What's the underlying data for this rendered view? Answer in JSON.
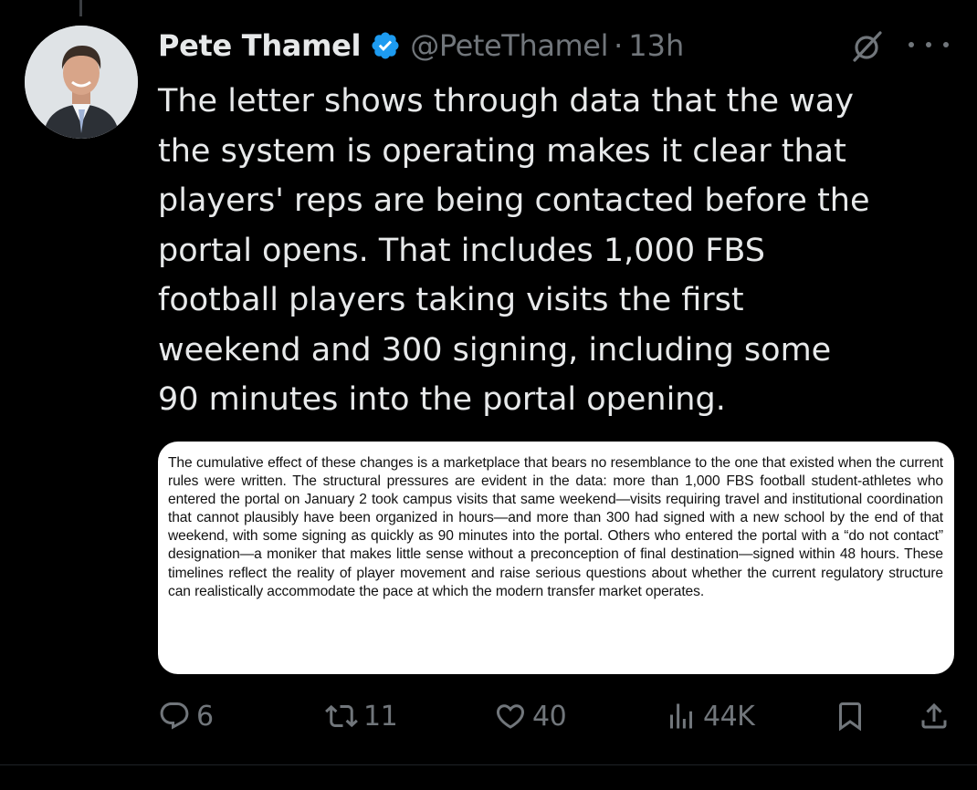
{
  "tweet": {
    "author_name": "Pete Thamel",
    "handle": "@PeteThamel",
    "separator": "·",
    "time": "13h",
    "text": "The letter shows through data that the way\nthe system is operating makes it clear that\nplayers' reps are being contacted before the\nportal opens. That includes 1,000 FBS\nfootball players taking visits the first\nweekend and 300 signing, including some\n90 minutes into the portal opening.",
    "media_text": "The cumulative effect of these changes is a marketplace that bears no resemblance to the one that existed when the current rules were written. The structural pressures are evident in the data: more than 1,000 FBS football student-athletes who entered the portal on January 2 took campus visits that same weekend—visits requiring travel and institutional coordination that cannot plausibly have been organized in hours—and more than 300 had signed with a new school by the end of that weekend, with some signing as quickly as 90 minutes into the portal. Others who entered the portal with a “do not contact” designation—a moniker that makes little sense without a preconception of final destination—signed within 48 hours. These timelines reflect the reality of player movement and raise serious questions about whether the current regulatory structure can realistically accommodate the pace at which the modern transfer market operates."
  },
  "actions": {
    "replies": "6",
    "reposts": "11",
    "likes": "40",
    "views": "44K"
  },
  "icons": {
    "verified": "verified-badge-icon",
    "grok": "grok-icon",
    "more": "more-icon",
    "reply": "reply-icon",
    "repost": "repost-icon",
    "like": "like-icon",
    "views": "views-icon",
    "bookmark": "bookmark-icon",
    "share": "share-icon"
  },
  "colors": {
    "background": "#000000",
    "text": "#e7e9ea",
    "muted": "#71767b",
    "verified": "#1d9bf0"
  }
}
